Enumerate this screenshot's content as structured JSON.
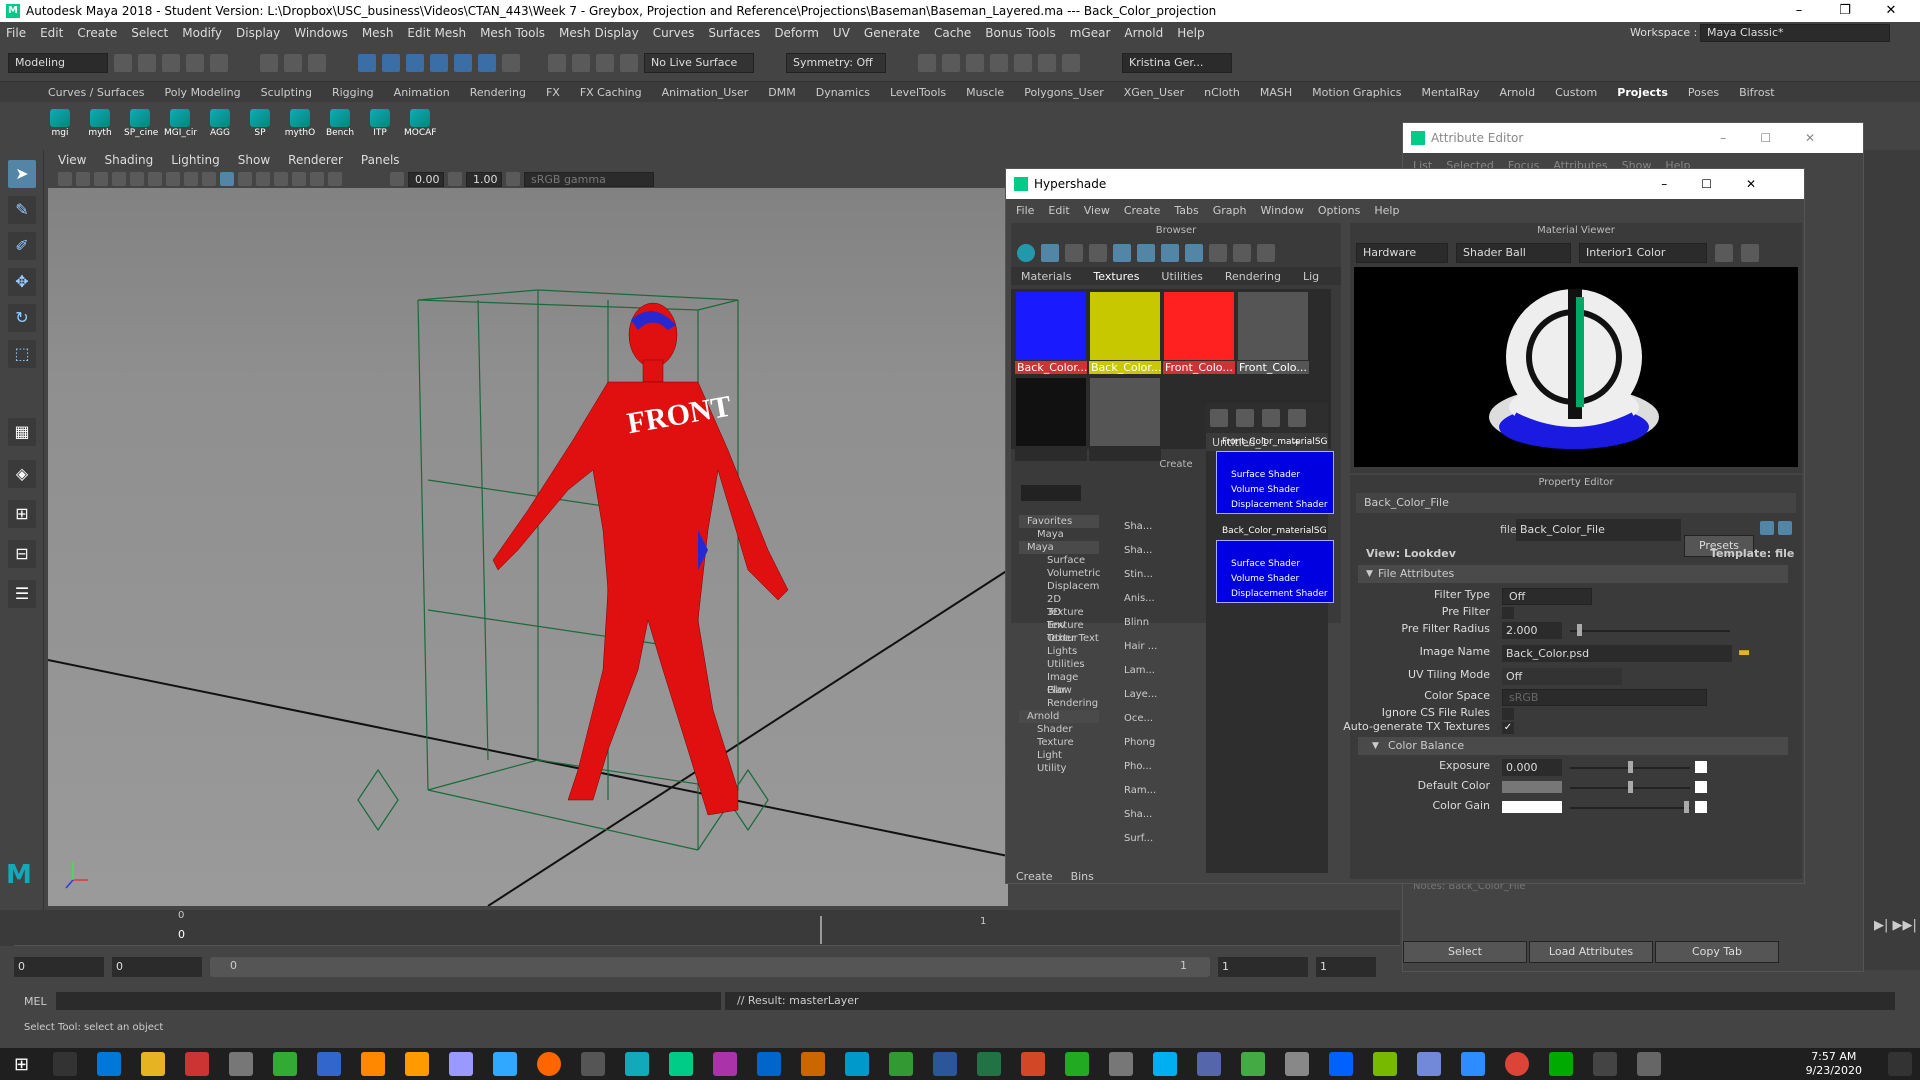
{
  "window": {
    "title": "Autodesk Maya 2018 - Student Version: L:\\Dropbox\\USC_business\\Videos\\CTAN_443\\Week 7 - Greybox, Projection and Reference\\Projections\\Baseman\\Baseman_Layered.ma  ---  Back_Color_projection"
  },
  "menu": [
    "File",
    "Edit",
    "Create",
    "Select",
    "Modify",
    "Display",
    "Windows",
    "Mesh",
    "Edit Mesh",
    "Mesh Tools",
    "Mesh Display",
    "Curves",
    "Surfaces",
    "Deform",
    "UV",
    "Generate",
    "Cache",
    "Bonus Tools",
    "mGear",
    "Arnold",
    "Help"
  ],
  "workspace": {
    "label": "Workspace :",
    "value": "Maya Classic*"
  },
  "status": {
    "mode": "Modeling",
    "live_surface": "No Live Surface",
    "symmetry": "Symmetry: Off",
    "user": "Kristina Ger..."
  },
  "shelf_tabs": [
    "Curves / Surfaces",
    "Poly Modeling",
    "Sculpting",
    "Rigging",
    "Animation",
    "Rendering",
    "FX",
    "FX Caching",
    "Animation_User",
    "DMM",
    "Dynamics",
    "LevelTools",
    "Muscle",
    "Polygons_User",
    "XGen_User",
    "nCloth",
    "MASH",
    "Motion Graphics",
    "MentalRay",
    "Arnold",
    "Custom",
    "Projects",
    "Poses",
    "Bifrost"
  ],
  "shelf_active": "Projects",
  "shelf_icons": [
    "mgi",
    "myth",
    "SP_cine",
    "MGI_cir",
    "AGG",
    "SP",
    "mythO",
    "Bench",
    "ITP",
    "MOCAF"
  ],
  "viewport": {
    "menu": [
      "View",
      "Shading",
      "Lighting",
      "Show",
      "Renderer",
      "Panels"
    ],
    "near": "0.00",
    "far": "1.00",
    "colorspace": "sRGB gamma",
    "front_text": "FRONT"
  },
  "hypershade": {
    "title": "Hypershade",
    "menu": [
      "File",
      "Edit",
      "View",
      "Create",
      "Tabs",
      "Graph",
      "Window",
      "Options",
      "Help"
    ],
    "browser_label": "Browser",
    "tabs": [
      "Materials",
      "Textures",
      "Utilities",
      "Rendering",
      "Lig"
    ],
    "active_tab": "Textures",
    "swatches": [
      {
        "label": "Back_Color...",
        "color": "#1a1aff"
      },
      {
        "label": "Back_Color...",
        "color": "#c8c800"
      },
      {
        "label": "Front_Colo...",
        "color": "#ff2020"
      },
      {
        "label": "Front_Colo...",
        "color": "#555"
      },
      {
        "label": "",
        "color": "#111"
      },
      {
        "label": "",
        "color": "#555"
      }
    ],
    "create_label": "Create",
    "tree": [
      {
        "t": "Favorites",
        "lv": 0
      },
      {
        "t": "Maya",
        "lv": 1
      },
      {
        "t": "Maya",
        "lv": 0
      },
      {
        "t": "Surface",
        "lv": 2
      },
      {
        "t": "Volumetric",
        "lv": 2
      },
      {
        "t": "Displacem",
        "lv": 2
      },
      {
        "t": "2D Texture",
        "lv": 2
      },
      {
        "t": "3D Texture",
        "lv": 2
      },
      {
        "t": "Env Textur",
        "lv": 2
      },
      {
        "t": "Other Text",
        "lv": 2
      },
      {
        "t": "Lights",
        "lv": 2
      },
      {
        "t": "Utilities",
        "lv": 2
      },
      {
        "t": "Image Plar",
        "lv": 2
      },
      {
        "t": "Glow",
        "lv": 2
      },
      {
        "t": "Rendering",
        "lv": 2
      },
      {
        "t": "Arnold",
        "lv": 0
      },
      {
        "t": "Shader",
        "lv": 1
      },
      {
        "t": "Texture",
        "lv": 1
      },
      {
        "t": "Light",
        "lv": 1
      },
      {
        "t": "Utility",
        "lv": 1
      }
    ],
    "shader_list": [
      "Sha...",
      "Sha...",
      "Stin...",
      "Anis...",
      "Blinn",
      "Hair ...",
      "Lam...",
      "Laye...",
      "Oce...",
      "Phong",
      "Pho...",
      "Ram...",
      "Sha...",
      "Surf..."
    ],
    "graph_tab": "Untitled_1",
    "nodes": [
      {
        "title": "Front_Color_materialSG",
        "ports": [
          "Surface Shader",
          "Volume Shader",
          "Displacement Shader"
        ]
      },
      {
        "title": "Back_Color_materialSG",
        "ports": [
          "Surface Shader",
          "Volume Shader",
          "Displacement Shader"
        ]
      }
    ],
    "bottom_tabs": [
      "Create",
      "Bins"
    ],
    "material_viewer": {
      "label": "Material Viewer",
      "renderer": "Hardware",
      "geometry": "Shader Ball",
      "env": "Interior1 Color"
    },
    "property_editor": {
      "label": "Property Editor",
      "node": "Back_Color_File",
      "file_label": "file:",
      "file_value": "Back_Color_File",
      "presets": "Presets",
      "view": "View: Lookdev",
      "template": "Template: file",
      "section1": "File Attributes",
      "filter_type": "Off",
      "pre_filter_radius": "2.000",
      "image_name": "Back_Color.psd",
      "uv_tiling": "Off",
      "color_space": "sRGB",
      "section2": "Color Balance",
      "exposure": "0.000",
      "labels": {
        "filter_type": "Filter Type",
        "pre_filter": "Pre Filter",
        "pre_filter_radius": "Pre Filter Radius",
        "image_name": "Image Name",
        "uv_tiling": "UV Tiling Mode",
        "color_space": "Color Space",
        "ignore_cs": "Ignore CS File Rules",
        "autogen": "Auto-generate TX Textures",
        "exposure": "Exposure",
        "default_color": "Default Color",
        "color_gain": "Color Gain"
      }
    }
  },
  "attribute_editor": {
    "title": "Attribute Editor",
    "menu": [
      "List",
      "Selected",
      "Focus",
      "Attributes",
      "Show",
      "Help"
    ],
    "buttons": [
      "Select",
      "Load Attributes",
      "Copy Tab"
    ],
    "notes": "Notes:  Back_Color_File"
  },
  "timeline": {
    "start": "0",
    "current": "0",
    "tick1": "1",
    "range_start": "0",
    "range_end": "0",
    "slider_start": "0",
    "slider_end": "1",
    "end1": "1",
    "end2": "1"
  },
  "cmdline": {
    "label": "MEL",
    "result": "// Result: masterLayer"
  },
  "helpline": "Select Tool: select an object",
  "taskbar": {
    "time": "7:57 AM",
    "date": "9/23/2020"
  }
}
